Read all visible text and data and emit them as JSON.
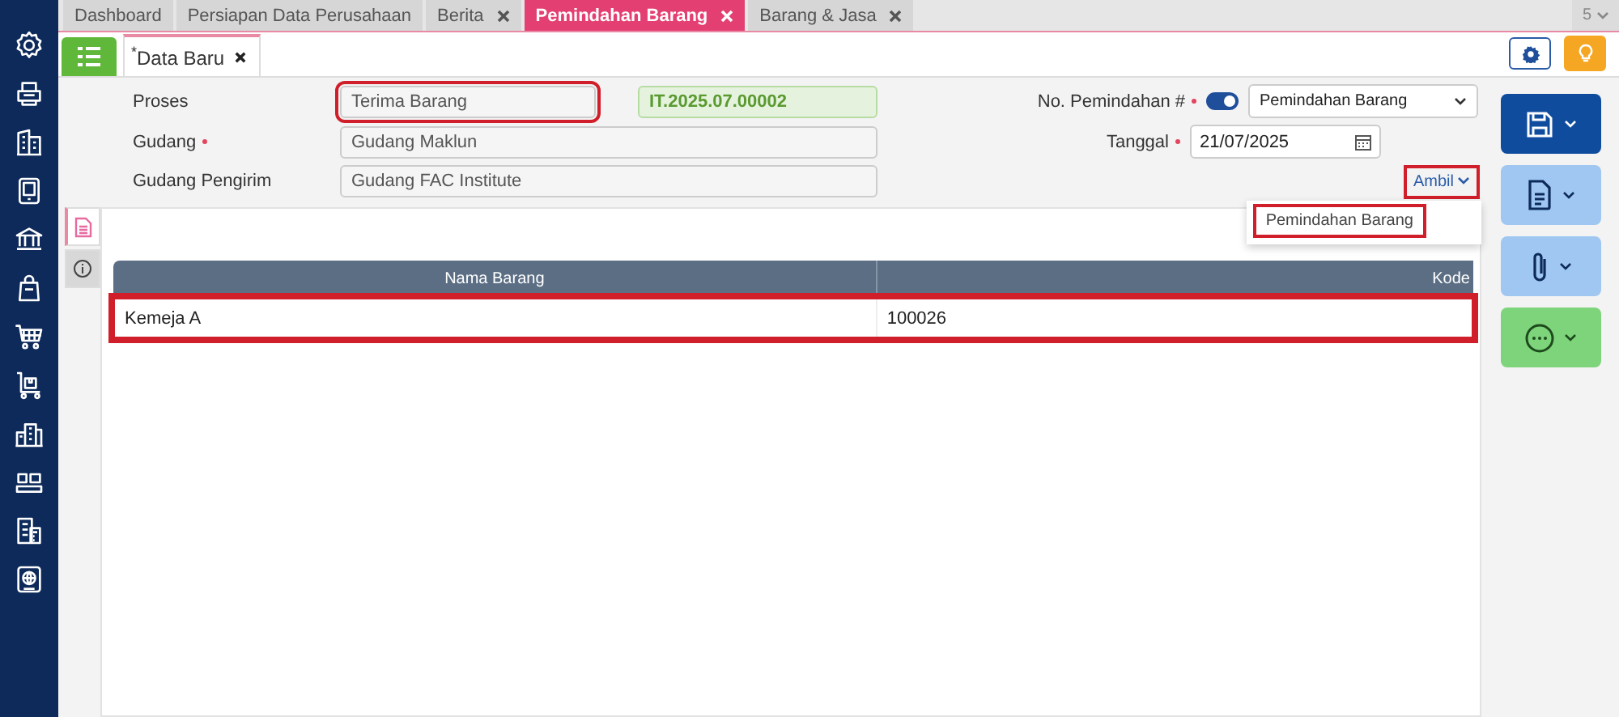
{
  "tabs": [
    {
      "label": "Dashboard",
      "closable": false,
      "selected": false
    },
    {
      "label": "Persiapan Data Perusahaan",
      "closable": false,
      "selected": false
    },
    {
      "label": "Berita",
      "closable": true,
      "selected": false
    },
    {
      "label": "Pemindahan Barang",
      "closable": true,
      "selected": true
    },
    {
      "label": "Barang & Jasa",
      "closable": true,
      "selected": false
    }
  ],
  "tab_overflow": "5",
  "doc_tab": {
    "marker": "*",
    "label": "Data Baru"
  },
  "form": {
    "proses": {
      "label": "Proses",
      "required": false,
      "value": "Terima Barang",
      "highlighted": true
    },
    "number": "IT.2025.07.00002",
    "gudang": {
      "label": "Gudang",
      "required": true,
      "value": "Gudang Maklun"
    },
    "gudang_pengirim": {
      "label": "Gudang Pengirim",
      "required": false,
      "value": "Gudang FAC Institute"
    },
    "no_pemindahan": {
      "label": "No. Pemindahan #",
      "required": true,
      "auto": true,
      "value": "Pemindahan Barang"
    },
    "tanggal": {
      "label": "Tanggal",
      "required": true,
      "value": "21/07/2025"
    }
  },
  "ambil": {
    "label": "Ambil",
    "highlighted": true,
    "menu": [
      {
        "label": "Pemindahan Barang",
        "highlighted": true
      }
    ]
  },
  "side_tabs": [
    {
      "selected": true
    },
    {
      "selected": false
    }
  ],
  "table": {
    "columns": [
      "Nama Barang",
      "Kode"
    ],
    "rows": [
      {
        "cells": [
          "Kemeja A",
          "100026"
        ],
        "highlighted": true
      }
    ]
  }
}
